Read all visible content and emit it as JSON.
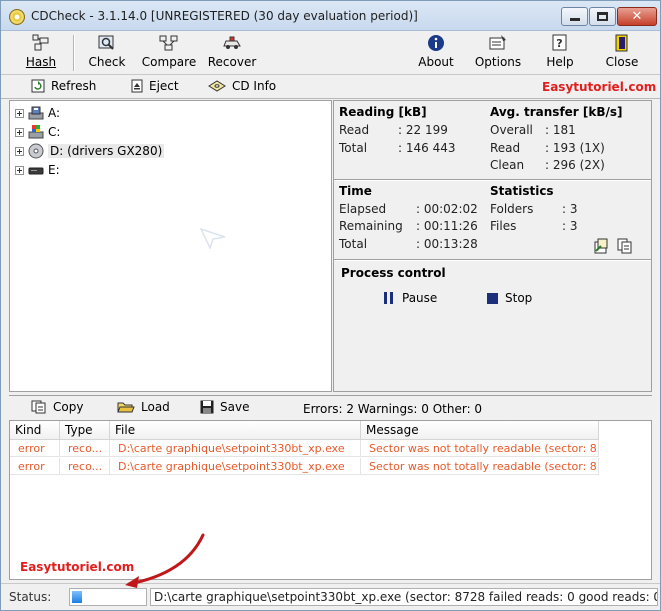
{
  "window": {
    "title": "CDCheck - 3.1.14.0 [UNREGISTERED (30 day evaluation period)]",
    "close_glyph": "✕"
  },
  "toolbar": {
    "hash": "Hash",
    "check": "Check",
    "compare": "Compare",
    "recover": "Recover",
    "about": "About",
    "options": "Options",
    "help": "Help",
    "close": "Close"
  },
  "subbar": {
    "refresh": "Refresh",
    "eject": "Eject",
    "cd_info": "CD Info",
    "brand": "Easytutoriel.com"
  },
  "tree": {
    "items": [
      {
        "label": "A:",
        "icon": "floppy-drive-icon"
      },
      {
        "label": "C:",
        "icon": "hard-drive-icon"
      },
      {
        "label": "D: (drivers  GX280)",
        "icon": "cd-drive-icon"
      },
      {
        "label": "E:",
        "icon": "removable-drive-icon"
      }
    ]
  },
  "info": {
    "reading": {
      "heading": "Reading [kB]",
      "read_label": "Read",
      "read_value": ": 22 199",
      "total_label": "Total",
      "total_value": ": 146 443"
    },
    "avg_transfer": {
      "heading": "Avg. transfer [kB/s]",
      "overall_label": "Overall",
      "overall_value": ": 181",
      "read_label": "Read",
      "read_value": ": 193 (1X)",
      "clean_label": "Clean",
      "clean_value": ": 296 (2X)"
    },
    "time": {
      "heading": "Time",
      "elapsed_label": "Elapsed",
      "elapsed_value": ": 00:02:02",
      "remaining_label": "Remaining",
      "remaining_value": ": 00:11:26",
      "total_label": "Total",
      "total_value": ": 00:13:28"
    },
    "statistics": {
      "heading": "Statistics",
      "folders_label": "Folders",
      "folders_value": ": 3",
      "files_label": "Files",
      "files_value": ": 3"
    },
    "process": {
      "heading": "Process control",
      "pause": "Pause",
      "stop": "Stop"
    }
  },
  "logbar": {
    "copy": "Copy",
    "load": "Load",
    "save": "Save",
    "summary": "Errors: 2 Warnings: 0 Other: 0"
  },
  "log": {
    "columns": [
      "Kind",
      "Type",
      "File",
      "Message"
    ],
    "rows": [
      {
        "kind": "error",
        "type": "reco...",
        "file": "D:\\carte graphique\\setpoint330bt_xp.exe",
        "message": "Sector was not totally readable (sector: 8..."
      },
      {
        "kind": "error",
        "type": "reco...",
        "file": "D:\\carte graphique\\setpoint330bt_xp.exe",
        "message": "Sector was not totally readable (sector: 8..."
      }
    ],
    "brand": "Easytutoriel.com"
  },
  "status": {
    "label": "Status:",
    "progress": 0.14,
    "message": "D:\\carte graphique\\setpoint330bt_xp.exe (sector: 8728 failed reads: 0 good reads: 0"
  },
  "colors": {
    "brand": "#e0201f",
    "error_text": "#e65a2b",
    "arrow": "#c0181a",
    "progress": "#1b7fe0"
  }
}
